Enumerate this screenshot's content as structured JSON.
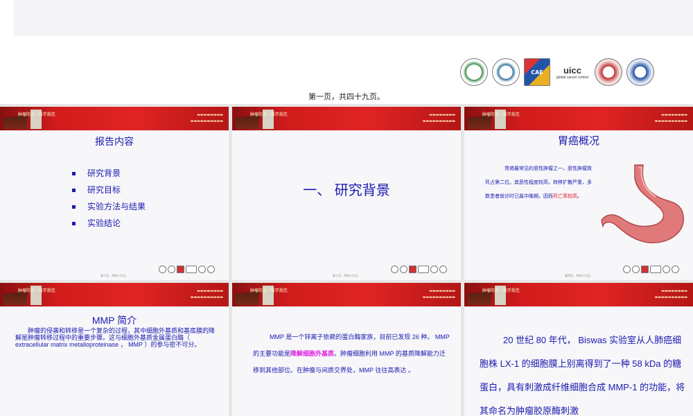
{
  "page": {
    "indicator": "第一页，共四十九页。",
    "logos": [
      "green-seal-logo",
      "teal-seal-logo",
      "cae-logo",
      "uicc-logo",
      "red-seal-logo",
      "blue-seal-logo"
    ],
    "uicc_text": "uicc",
    "uicc_sub": "global cancer control",
    "cae_text": "CAE"
  },
  "banner": {
    "slogan": "肿瘤防治 · 科学规范"
  },
  "slides": [
    {
      "title": "报告内容",
      "items": [
        "研究背景",
        "研究目标",
        "实验方法与结果",
        "实验结论"
      ],
      "footer": "第二页，共四十九页。"
    },
    {
      "title": "一、  研究背景",
      "footer": "第三页，共四十九页。"
    },
    {
      "title": "胃癌概况",
      "para_1": "胃癌最常见的恶性肿瘤之一，恶性肿瘤致死占第二位。其恶性程度较高，转移扩散严重，多数患者就诊时已属中晚期，因而",
      "para_hl": "死亡率较高",
      "para_2": "。",
      "footer": "第四页，共四十九页。"
    },
    {
      "title": "MMP 简介",
      "para": "肿瘤的侵袭和转移是一个复杂的过程，其中细胞外基质和基底膜的降解是肿瘤转移过程中的重要步骤。这与细胞外基质金属蛋白酶（ extracellular matrix metalloproteinase ， MMP ）的参与密不可分。"
    },
    {
      "para_1": "MMP 是一个锌离子依赖的蛋白酶家族，目前已发现 26 种。 MMP 的主要功能是",
      "para_hl": "降解细胞外基质",
      "para_2": "。肿瘤细胞利用 MMP 的基质降解能力迁移到其他部位。在肿瘤与间质交界处，MMP 往往高表达 。"
    },
    {
      "para": "20 世纪 80 年代， Biswas 实验室从人肺癌细胞株 LX-1 的细胞膜上别离得到了一种 58 kDa 的糖蛋白，具有刺激成纤维细胞合成 MMP-1 的功能，将其命名为肿瘤胶原酶刺激"
    }
  ]
}
